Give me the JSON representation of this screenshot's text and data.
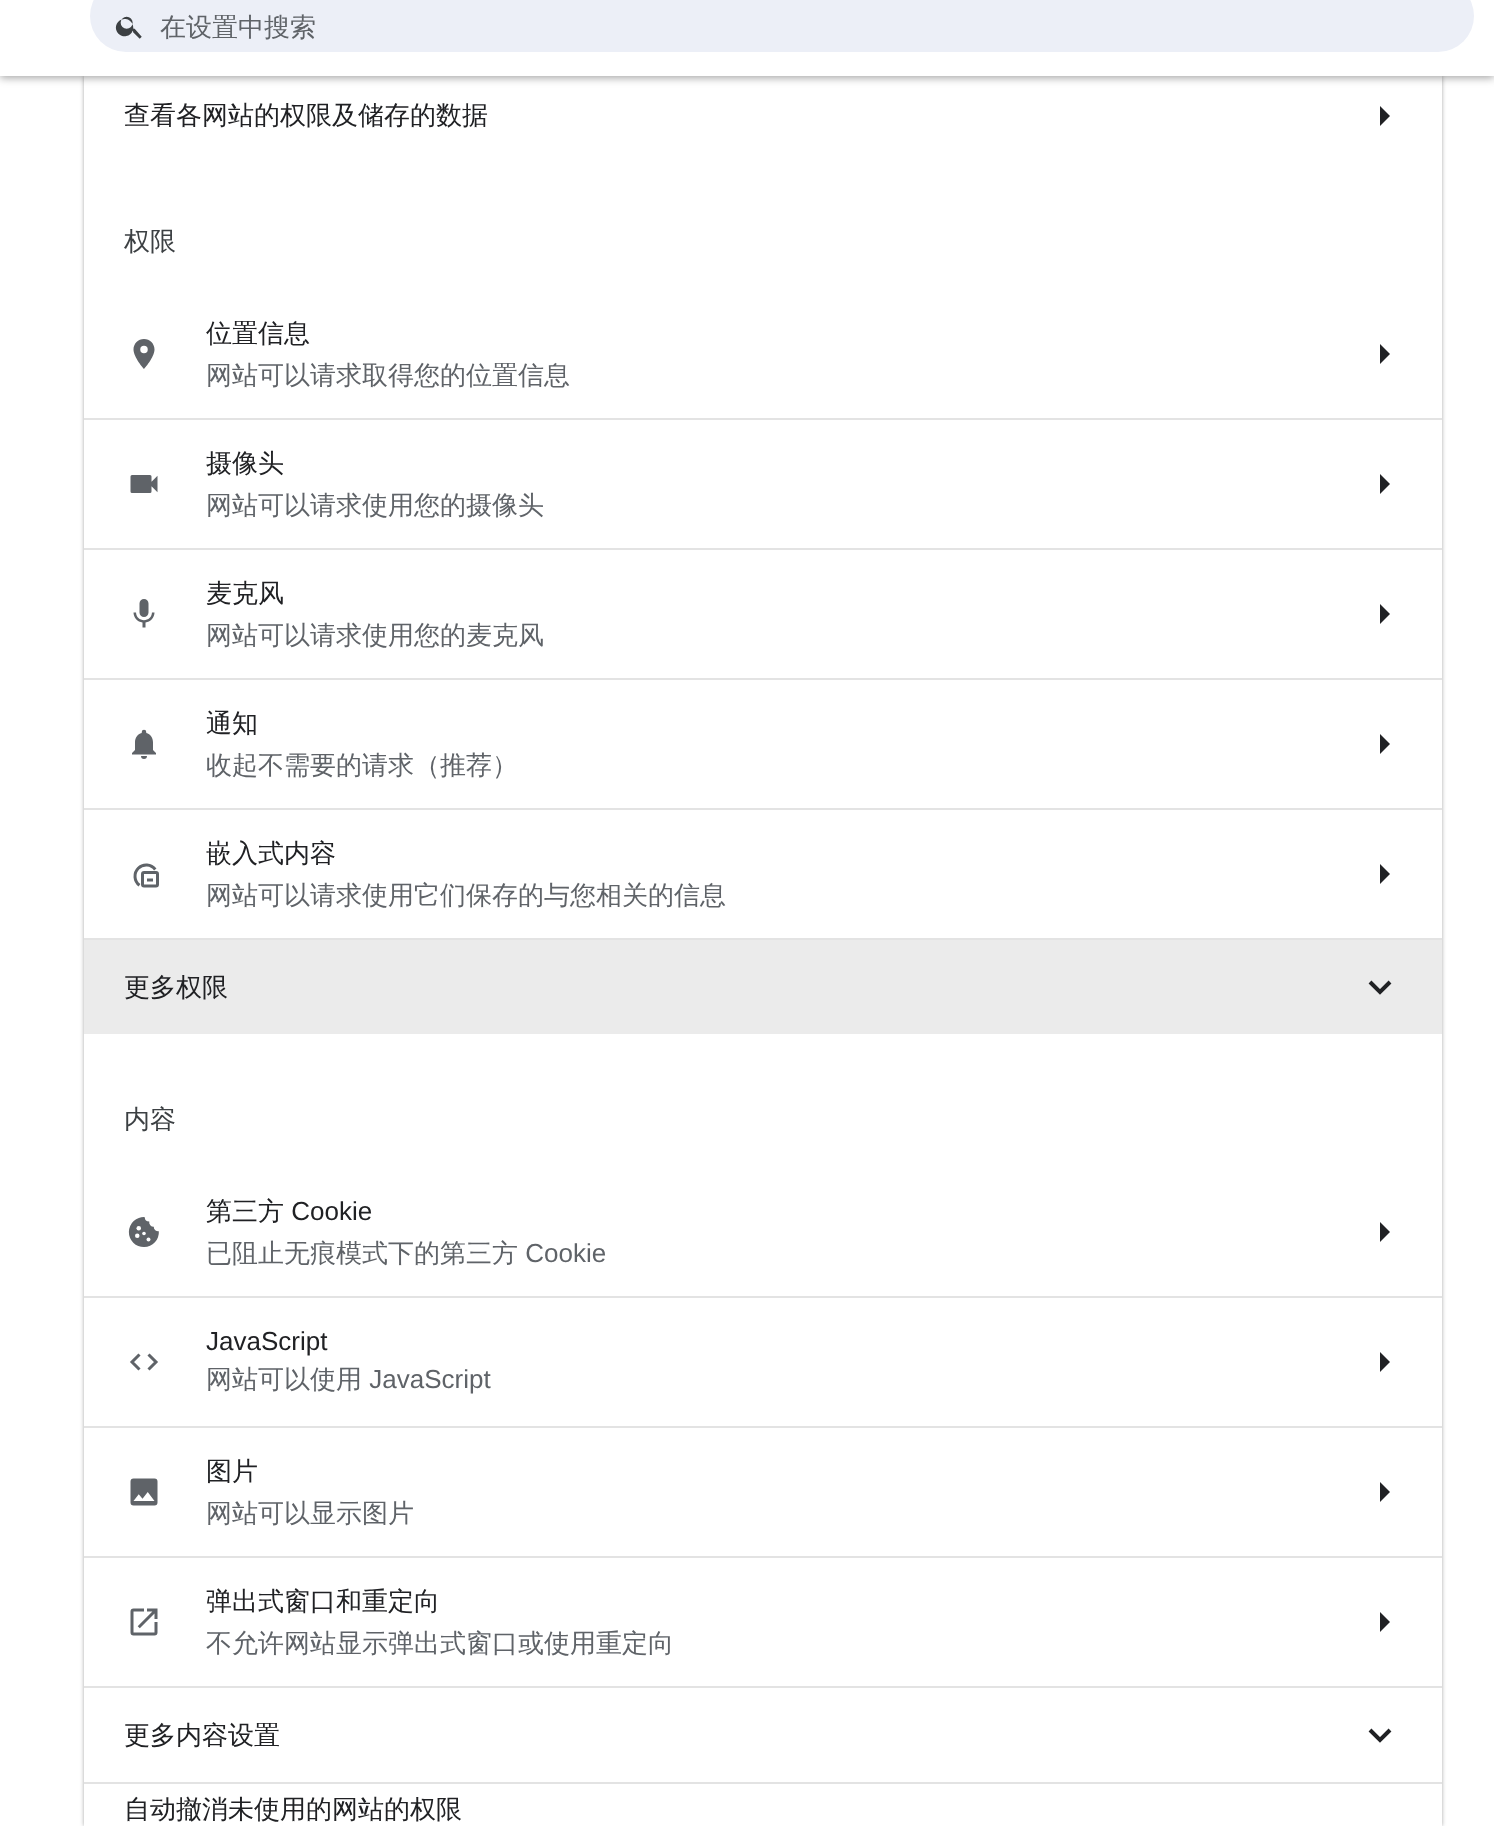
{
  "search": {
    "placeholder": "在设置中搜索"
  },
  "card": {
    "items": [
      {
        "kind": "link",
        "label": "查看各网站的权限及储存的数据"
      },
      {
        "kind": "heading",
        "label": "权限"
      },
      {
        "kind": "setting",
        "title": "位置信息",
        "subtitle": "网站可以请求取得您的位置信息"
      },
      {
        "kind": "setting",
        "title": "摄像头",
        "subtitle": "网站可以请求使用您的摄像头"
      },
      {
        "kind": "setting",
        "title": "麦克风",
        "subtitle": "网站可以请求使用您的麦克风"
      },
      {
        "kind": "setting",
        "title": "通知",
        "subtitle": "收起不需要的请求（推荐）"
      },
      {
        "kind": "setting",
        "title": "嵌入式内容",
        "subtitle": "网站可以请求使用它们保存的与您相关的信息"
      },
      {
        "kind": "expander",
        "label": "更多权限",
        "expanded": false,
        "highlighted": true
      },
      {
        "kind": "heading",
        "label": "内容"
      },
      {
        "kind": "setting",
        "title": "第三方 Cookie",
        "subtitle": "已阻止无痕模式下的第三方 Cookie"
      },
      {
        "kind": "setting",
        "title": "JavaScript",
        "subtitle": "网站可以使用 JavaScript"
      },
      {
        "kind": "setting",
        "title": "图片",
        "subtitle": "网站可以显示图片"
      },
      {
        "kind": "setting",
        "title": "弹出式窗口和重定向",
        "subtitle": "不允许网站显示弹出式窗口或使用重定向"
      },
      {
        "kind": "expander",
        "label": "更多内容设置",
        "expanded": false,
        "highlighted": false
      },
      {
        "kind": "row-title",
        "label": "自动撤消未使用的网站的权限"
      }
    ]
  }
}
